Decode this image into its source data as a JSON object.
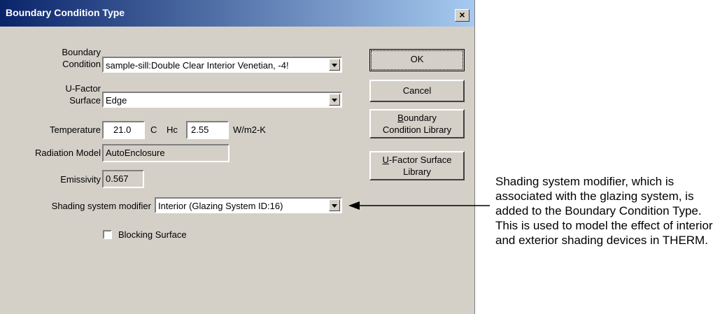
{
  "dialog": {
    "title": "Boundary Condition Type",
    "close_glyph": "×",
    "fields": {
      "boundary_condition_label_1": "Boundary",
      "boundary_condition_label_2": "Condition",
      "boundary_condition_value": "sample-sill:Double Clear Interior Venetian, -4!",
      "ufactor_label_1": "U-Factor",
      "ufactor_label_2": "Surface",
      "ufactor_value": "Edge",
      "temperature_label": "Temperature",
      "temperature_value": "21.0",
      "temperature_unit": "C",
      "hc_label": "Hc",
      "hc_value": "2.55",
      "hc_unit": "W/m2-K",
      "radiation_label": "Radiation Model",
      "radiation_value": "AutoEnclosure",
      "emissivity_label": "Emissivity",
      "emissivity_value": "0.567",
      "shading_label": "Shading system modifier",
      "shading_value": "Interior (Glazing System ID:16)",
      "blocking_label": "Blocking Surface"
    },
    "buttons": {
      "ok": "OK",
      "cancel": "Cancel",
      "bc_library_1": "oundary",
      "bc_library_mnemonic": "B",
      "bc_library_2": "Condition Library",
      "ufs_library_mnemonic": "U",
      "ufs_library_1": "-Factor Surface",
      "ufs_library_2": "Library"
    }
  },
  "annotation": {
    "text": "Shading system modifier, which is associated with the glazing system, is added to the Boundary Condition Type. This is used to model the effect of interior and exterior shading devices in THERM."
  }
}
